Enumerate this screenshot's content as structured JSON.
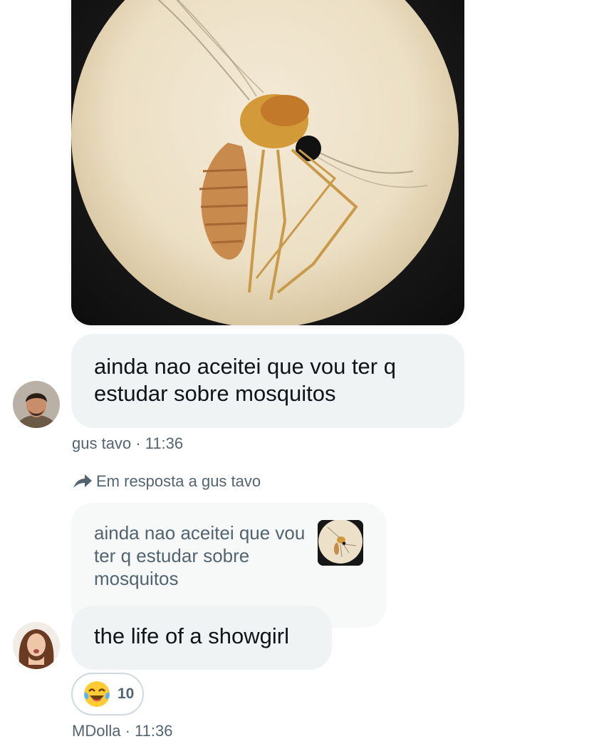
{
  "conversation": {
    "image_message": {
      "alt": ""
    },
    "message_1": {
      "text": "ainda nao aceitei que vou ter q estudar sobre mosquitos",
      "sender": "gus tavo",
      "time": "11:36",
      "meta": "gus tavo · 11:36"
    },
    "reply": {
      "indicator_icon": "reply-arrow-icon",
      "indicator_label": "Em resposta a gus tavo",
      "quoted_text": "ainda nao aceitei que vou ter q estudar sobre mosquitos",
      "quoted_thumbnail": "mosquito-image-thumbnail"
    },
    "message_2": {
      "text": "the life of a showgirl",
      "sender": "MDolla",
      "time": "11:36",
      "meta": "MDolla · 11:36",
      "reaction": {
        "emoji_icon": "tears-of-joy-emoji-icon",
        "count": "10"
      }
    }
  },
  "colors": {
    "bubble_bg": "#eff3f4",
    "quote_bg": "#f7f9f9",
    "meta_text": "#536471",
    "primary_text": "#0f1419"
  }
}
